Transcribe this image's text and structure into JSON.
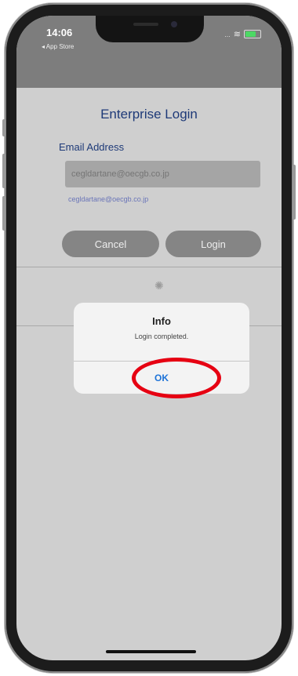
{
  "status": {
    "time": "14:06",
    "back_label": "◂ App Store",
    "signal": "...",
    "wifi_glyph": "≋"
  },
  "page": {
    "title": "Enterprise Login",
    "email_label": "Email Address",
    "email_placeholder": "cegldartane@oecgb.co.jp",
    "email_hint": "cegldartane@oecgb.co.jp"
  },
  "buttons": {
    "cancel": "Cancel",
    "login": "Login"
  },
  "spinner_glyph": "✺",
  "alert": {
    "title": "Info",
    "message": "Login completed.",
    "ok": "OK"
  },
  "colors": {
    "accent": "#1d73d8",
    "title": "#1e3a78",
    "annotation": "#e60012"
  }
}
